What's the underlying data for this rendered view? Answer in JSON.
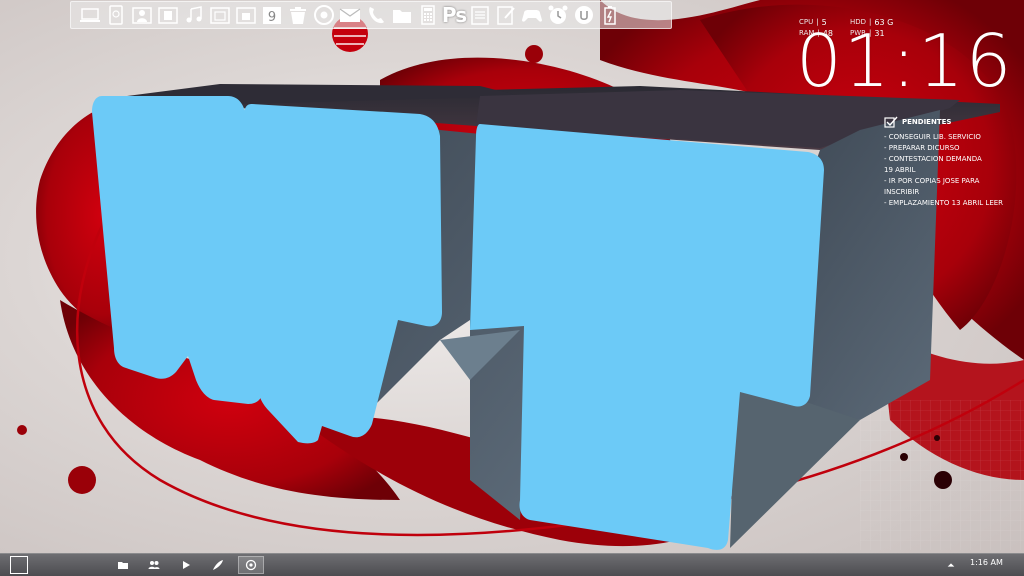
{
  "dock": {
    "icons": [
      {
        "name": "computer-icon"
      },
      {
        "name": "hard-drive-icon"
      },
      {
        "name": "user-folder-icon"
      },
      {
        "name": "documents-icon"
      },
      {
        "name": "music-icon"
      },
      {
        "name": "pictures-icon"
      },
      {
        "name": "downloads-icon"
      },
      {
        "name": "calendar-icon"
      },
      {
        "name": "recycle-bin-icon"
      },
      {
        "name": "chrome-icon"
      },
      {
        "name": "mail-icon"
      },
      {
        "name": "phone-icon"
      },
      {
        "name": "folder-icon"
      },
      {
        "name": "calculator-icon"
      },
      {
        "name": "photoshop-icon",
        "label": "Ps"
      },
      {
        "name": "word-icon"
      },
      {
        "name": "notepad-icon"
      },
      {
        "name": "gamepad-icon"
      },
      {
        "name": "alarm-clock-icon"
      },
      {
        "name": "utorrent-icon"
      },
      {
        "name": "battery-icon"
      }
    ]
  },
  "stats": {
    "cpu_label": "CPU",
    "cpu_value": "5",
    "ram_label": "RAM",
    "ram_value": "48",
    "hdd_label": "HDD",
    "hdd_value": "63 G",
    "pwr_label": "PWR",
    "pwr_value": "31"
  },
  "clock": {
    "time": "01:16"
  },
  "tasks": {
    "title": "PENDIENTES",
    "items": [
      "- CONSEGUIR LIB. SERVICIO",
      "- PREPARAR DICURSO",
      "- CONTESTACION DEMANDA\n  19 ABRIL",
      "- IR POR COPIAS JOSE PARA\nINSCRIBIR",
      "- EMPLAZAMIENTO 13 ABRIL LEER"
    ]
  },
  "taskbar": {
    "tray_time": "1:16 AM",
    "items": [
      {
        "name": "file-explorer-icon"
      },
      {
        "name": "contacts-icon"
      },
      {
        "name": "media-player-icon"
      },
      {
        "name": "feather-icon"
      },
      {
        "name": "chrome-taskbar-icon"
      }
    ]
  },
  "colors": {
    "accent_red": "#b0000a",
    "letter_blue": "#6ccaf7",
    "letter_side": "#4a5866"
  }
}
